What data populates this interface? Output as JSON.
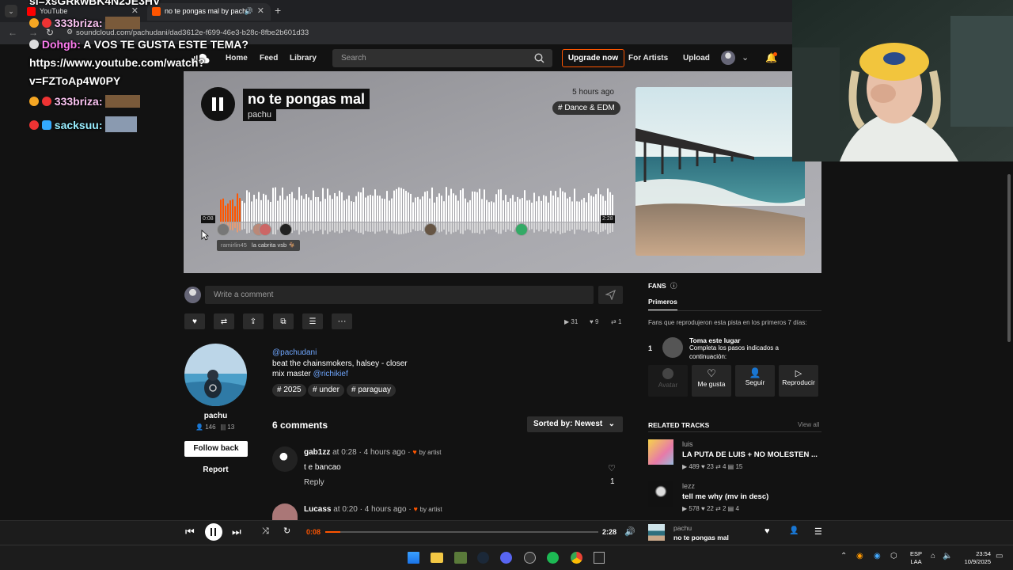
{
  "browser": {
    "tabs": [
      {
        "label": "YouTube",
        "active": false
      },
      {
        "label": "no te pongas mal by pachu",
        "active": true
      }
    ],
    "url": "soundcloud.com/pachudani/dad3612e-f699-46e3-b28c-8fbe2b601d33"
  },
  "nav": {
    "home": "Home",
    "feed": "Feed",
    "library": "Library",
    "search_placeholder": "Search",
    "upgrade": "Upgrade now",
    "for_artists": "For Artists",
    "upload": "Upload"
  },
  "track": {
    "title": "no te pongas mal",
    "artist": "pachu",
    "posted": "5 hours ago",
    "genre": "# Dance & EDM",
    "elapsed": "0:08",
    "duration": "2:28",
    "tooltip_user": "ramirlin45",
    "tooltip_text": "la cabrita vsb 🐐",
    "progress": 0.054
  },
  "comment_box": {
    "placeholder": "Write a comment"
  },
  "stats": {
    "plays": "31",
    "likes": "9",
    "reposts": "1"
  },
  "artist_panel": {
    "name": "pachu",
    "followers": "146",
    "tracks": "13",
    "follow_back": "Follow back",
    "report": "Report"
  },
  "description": {
    "mention": "@pachudani",
    "line2": "beat the chainsmokers, halsey - closer",
    "line3_prefix": "mix master ",
    "line3_mention": "@richikief",
    "tags": [
      "# 2025",
      "# under",
      "# paraguay"
    ]
  },
  "comments": {
    "count_label": "6 comments",
    "sorted_label": "Sorted by: Newest",
    "items": [
      {
        "user": "gab1zz",
        "at": "at",
        "time": "0:28",
        "ago": "· 4 hours ago ·",
        "by_artist": "by artist",
        "text": "t e bancao",
        "reply": "Reply",
        "likes": "1"
      },
      {
        "user": "Lucass",
        "at": "at",
        "time": "0:20",
        "ago": "· 4 hours ago ·",
        "by_artist": "by artist"
      }
    ]
  },
  "fans": {
    "header": "FANS",
    "tab": "Primeros",
    "desc": "Fans que reprodujeron esta pista en los primeros 7 días:",
    "rank": "1",
    "claim_title": "Toma este lugar",
    "claim_text1": "Completa los pasos indicados a",
    "claim_text2": "continuación:",
    "steps": [
      "Avatar",
      "Me gusta",
      "Seguir",
      "Reproducir"
    ]
  },
  "related": {
    "header": "RELATED TRACKS",
    "view_all": "View all",
    "items": [
      {
        "artist": "luis",
        "title": "LA PUTA DE LUIS + NO MOLESTEN ...",
        "plays": "489",
        "likes": "23",
        "reposts": "4",
        "comments": "15"
      },
      {
        "artist": "lezz",
        "title": "tell me why (mv in desc)",
        "plays": "578",
        "likes": "22",
        "reposts": "2",
        "comments": "4"
      }
    ]
  },
  "player": {
    "elapsed": "0:08",
    "duration": "2:28",
    "artist": "pachu",
    "title": "no te pongas mal",
    "progress": 0.054
  },
  "taskbar": {
    "lang1": "ESP",
    "lang2": "LAA",
    "time": "23:54",
    "date": "10/9/2025"
  },
  "chat": {
    "top_cut": "si=xsGRkwBK4N2JE3HV",
    "l1_user": "333briza:",
    "l2_user": "Dohgb:",
    "l2_msg": "A VOS TE GUSTA ESTE TEMA?",
    "l3": "https://www.youtube.com/watch?",
    "l4": "v=FZToAp4W0PY",
    "l5_user": "333briza:",
    "l6_user": "sacksuu:"
  },
  "colors": {
    "accent": "#ff5500",
    "link": "#6fa7ff",
    "background": "#121212"
  }
}
